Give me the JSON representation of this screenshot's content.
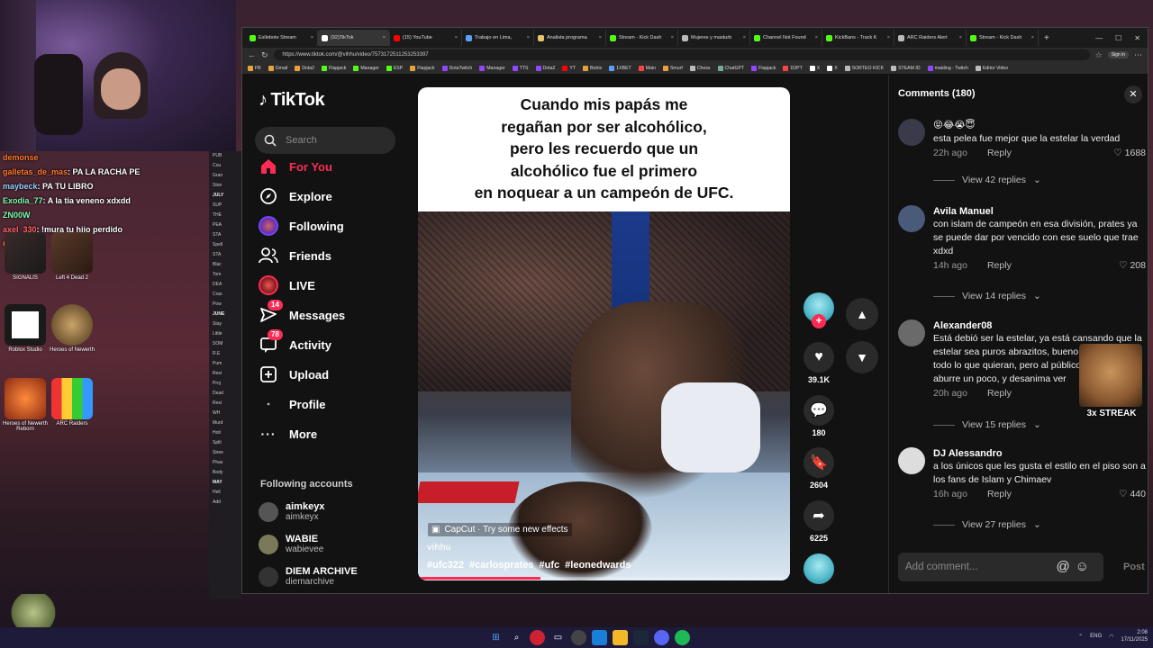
{
  "overlay": {
    "chat": [
      {
        "user": "demonse",
        "msg": "",
        "color": "u1"
      },
      {
        "user": "galletas_de_mas",
        "msg": "PA LA RACHA PE",
        "color": "u1"
      },
      {
        "user": "maybeck",
        "msg": "PA TU LIBRO",
        "color": "u2"
      },
      {
        "user": "Exodia_77",
        "msg": "A la tia veneno xdxdd",
        "color": "u3"
      },
      {
        "user": "ZN00W",
        "msg": "",
        "color": "u3"
      },
      {
        "user": "axel_330",
        "msg": "!mura tu hijo perdido",
        "color": "u4"
      },
      {
        "user": "Gomez",
        "msg": "",
        "color": "u1"
      }
    ],
    "desktop_icons": [
      {
        "label": "SIGNALIS"
      },
      {
        "label": "Left 4 Dead 2"
      },
      {
        "label": "Roblox Studio"
      },
      {
        "label": "Heroes of Newerth"
      },
      {
        "label": "Heroes of Newerth Reborn"
      },
      {
        "label": "ARC Raiders"
      }
    ],
    "side_list": [
      "PUB",
      "Cou",
      "Gran",
      "Ston",
      "JULY",
      "SUP",
      "THE",
      "PEA",
      "STA",
      "Spell",
      "STA",
      "Blac",
      "Tom",
      "DEA",
      "Cras",
      "Pow",
      "JUNE",
      "Stay",
      "Little",
      "SOM",
      "R.E",
      "Pum",
      "Resi",
      "Proj",
      "Dead",
      "Resi",
      "WH",
      "Murd",
      "Hotl",
      "Split",
      "Stree",
      "Phas",
      "Body",
      "MAY",
      "Hell",
      "Add"
    ],
    "streak": "3x STREAK"
  },
  "browser": {
    "tabs": [
      {
        "title": "Esllebote Stream",
        "color": "#53fc18",
        "active": false
      },
      {
        "title": "(92)TikTok",
        "color": "#ffffff",
        "active": true
      },
      {
        "title": "(15) YouTube",
        "color": "#ff0000",
        "active": false
      },
      {
        "title": "Trabajo en Lima,",
        "color": "#5aa0ff",
        "active": false
      },
      {
        "title": "Analista programa",
        "color": "#e9c46a",
        "active": false
      },
      {
        "title": "Stream - Kick Dash",
        "color": "#53fc18",
        "active": false
      },
      {
        "title": "Mujeres y masturb",
        "color": "#bbbbbb",
        "active": false
      },
      {
        "title": "Channel Not Found",
        "color": "#53fc18",
        "active": false
      },
      {
        "title": "KickBans - Track K",
        "color": "#53fc18",
        "active": false
      },
      {
        "title": "ARC Raiders Alert",
        "color": "#bbbbbb",
        "active": false
      },
      {
        "title": "Stream - Kick Dash",
        "color": "#53fc18",
        "active": false
      }
    ],
    "url": "https://www.tiktok.com/@vihhu/video/7573172511253253397",
    "signin": "Sign in",
    "bookmarks": [
      {
        "label": "FB",
        "color": "#e9a23b"
      },
      {
        "label": "Gmail",
        "color": "#e9a23b"
      },
      {
        "label": "Dota2",
        "color": "#e9a23b"
      },
      {
        "label": "Flapjack",
        "color": "#53fc18"
      },
      {
        "label": "Manager",
        "color": "#53fc18"
      },
      {
        "label": "ESP",
        "color": "#53fc18"
      },
      {
        "label": "Flapjack",
        "color": "#e9a23b"
      },
      {
        "label": "DotaTwitch",
        "color": "#9146ff"
      },
      {
        "label": "Manager",
        "color": "#9146ff"
      },
      {
        "label": "TTS",
        "color": "#9146ff"
      },
      {
        "label": "Dota2",
        "color": "#9146ff"
      },
      {
        "label": "YT",
        "color": "#ff0000"
      },
      {
        "label": "Botrix",
        "color": "#e9a23b"
      },
      {
        "label": "1XBET",
        "color": "#5aa0ff"
      },
      {
        "label": "Main",
        "color": "#ff4444"
      },
      {
        "label": "Smurf",
        "color": "#e9a23b"
      },
      {
        "label": "Chess",
        "color": "#bbbbbb"
      },
      {
        "label": "ChatGPT",
        "color": "#74aa9c"
      },
      {
        "label": "Flapjack",
        "color": "#9146ff"
      },
      {
        "label": "D2PT",
        "color": "#ff4444"
      },
      {
        "label": "X",
        "color": "#ffffff"
      },
      {
        "label": "X",
        "color": "#ffffff"
      },
      {
        "label": "SORTEO KICK",
        "color": "#bbbbbb"
      },
      {
        "label": "STEAM ID",
        "color": "#bbbbbb"
      },
      {
        "label": "maiding - Twitch",
        "color": "#9146ff"
      },
      {
        "label": "Editor Video",
        "color": "#bbbbbb"
      }
    ]
  },
  "tiktok": {
    "logo": "TikTok",
    "search_placeholder": "Search",
    "nav": [
      {
        "label": "For You",
        "icon": "home-icon",
        "badge": "",
        "active": true
      },
      {
        "label": "Explore",
        "icon": "compass-icon",
        "badge": "",
        "active": false
      },
      {
        "label": "Following",
        "icon": "following-avatar-icon",
        "badge": "",
        "active": false
      },
      {
        "label": "Friends",
        "icon": "friends-icon",
        "badge": "",
        "active": false
      },
      {
        "label": "LIVE",
        "icon": "live-avatar-icon",
        "badge": "",
        "active": false
      },
      {
        "label": "Messages",
        "icon": "messages-icon",
        "badge": "14",
        "active": false
      },
      {
        "label": "Activity",
        "icon": "activity-icon",
        "badge": "78",
        "active": false
      },
      {
        "label": "Upload",
        "icon": "upload-icon",
        "badge": "",
        "active": false
      },
      {
        "label": "Profile",
        "icon": "profile-icon",
        "badge": "",
        "active": false
      },
      {
        "label": "More",
        "icon": "more-icon",
        "badge": "",
        "active": false
      }
    ],
    "following_header": "Following accounts",
    "following": [
      {
        "name": "aimkeyx",
        "handle": "aimkeyx",
        "color": "#555"
      },
      {
        "name": "WABIE",
        "handle": "wabievee",
        "color": "#7a7a5a"
      },
      {
        "name": "DIEM ARCHIVE",
        "handle": "diemarchive",
        "color": "#333"
      }
    ],
    "video": {
      "caption_lines": [
        "Cuando mis papás me",
        "regañan por ser alcohólico,",
        "pero les recuerdo que un",
        "alcohólico fue el primero",
        "en noquear a un campeón de UFC."
      ],
      "capcut": "CapCut · Try some new effects",
      "author": "vihhu",
      "tags": [
        "#ufc322",
        "#carlosprates",
        "#ufc",
        "#leonedwards"
      ],
      "progress": 0.33
    },
    "actions": {
      "likes": "39.1K",
      "comments": "180",
      "saves": "2604",
      "shares": "6225"
    },
    "comments_panel": {
      "title": "Comments (180)",
      "items": [
        {
          "user": "",
          "text": "😝😂😭😇",
          "text2": "esta pelea fue mejor que la estelar la verdad",
          "time": "22h ago",
          "reply": "Reply",
          "likes": "1688",
          "replies": "View 42 replies",
          "avatar": "#3a3a4a"
        },
        {
          "user": "Avila Manuel",
          "text": "con islam de campeón en esa división, prates ya se puede dar por vencido con ese suelo que trae xdxd",
          "text2": "",
          "time": "14h ago",
          "reply": "Reply",
          "likes": "208",
          "replies": "View 14 replies",
          "avatar": "#4a5a7a"
        },
        {
          "user": "Alexander08",
          "text": "Está debió ser la estelar, ya está cansando que la estelar sea puros abrazitos, bueno que hagan todo lo que quieran, pero al público hay que le aburre un poco, y desanima ver",
          "text2": "",
          "time": "20h ago",
          "reply": "Reply",
          "likes": "",
          "replies": "View 15 replies",
          "avatar": "#6a6a6a"
        },
        {
          "user": "DJ Alessandro",
          "text": "a los únicos que les gusta el estilo en el piso son a los fans de Islam y Chimaev",
          "text2": "",
          "time": "16h ago",
          "reply": "Reply",
          "likes": "440",
          "replies": "View 27 replies",
          "avatar": "#dddddd"
        }
      ],
      "input_placeholder": "Add comment...",
      "post": "Post"
    }
  },
  "taskbar": {
    "lang": "ENG",
    "time": "2:08",
    "date": "17/11/2025"
  }
}
